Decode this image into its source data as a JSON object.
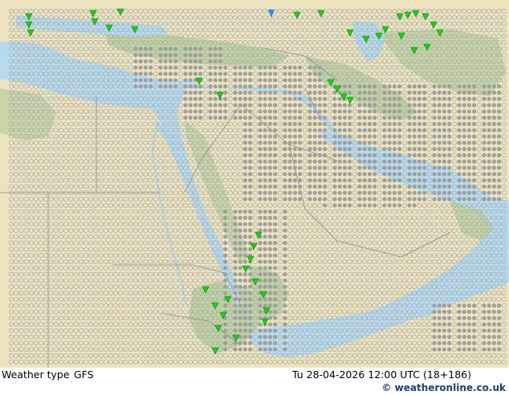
{
  "footer": {
    "product": "Weather type",
    "model": "GFS",
    "datetime": "Tu 28-04-2026 12:00 UTC (18+186)",
    "copyright": "© weatheronline.co.uk"
  },
  "colors": {
    "sea": "#b6dbef",
    "land": "#ece3bf",
    "highland": "#b8cf9c",
    "border": "#8a8a8a",
    "symbol_outline": "#a7a7a7",
    "symbol_grey": "#9f9f9f",
    "rain_green": "#18d218",
    "snow_blue": "#1e90ff"
  },
  "legend_icons": {
    "open_circle": "no significant weather",
    "grey_disc": "cloudy",
    "green_drop": "rain shower",
    "blue_drop": "snow"
  }
}
